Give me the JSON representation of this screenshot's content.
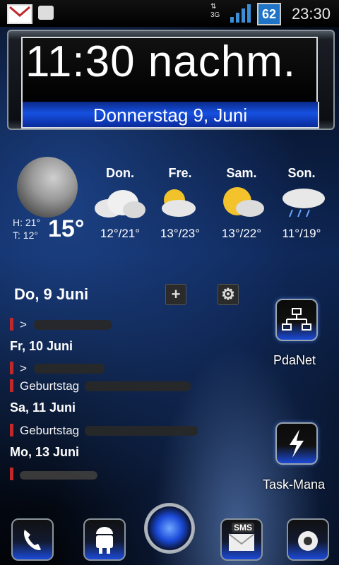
{
  "status_bar": {
    "network": "3G",
    "battery_level": "62",
    "time": "23:30"
  },
  "clock": {
    "time": "11:30 nachm.",
    "date": "Donnerstag 9, Juni"
  },
  "weather": {
    "current": {
      "high": "H: 21°",
      "low": "T: 12°",
      "temp": "15°"
    },
    "forecast": [
      {
        "day": "Don.",
        "range": "12°/21°",
        "icon": "cloudy-icon"
      },
      {
        "day": "Fre.",
        "range": "13°/23°",
        "icon": "partly-cloudy-icon"
      },
      {
        "day": "Sam.",
        "range": "13°/22°",
        "icon": "partly-sunny-icon"
      },
      {
        "day": "Son.",
        "range": "11°/19°",
        "icon": "rain-icon"
      }
    ]
  },
  "agenda": {
    "header": "Do, 9 Juni",
    "groups": [
      {
        "date": "Fr, 10 Juni",
        "events": [
          ">",
          "Geburtstag"
        ]
      },
      {
        "date": "Sa, 11 Juni",
        "events": [
          "Geburtstag"
        ]
      },
      {
        "date": "Mo, 13 Juni",
        "events": [
          ""
        ]
      }
    ],
    "first_event": ">"
  },
  "shortcuts": [
    {
      "label": "PdaNet",
      "icon": "network-icon"
    },
    {
      "label": "Task-Mana",
      "icon": "lightning-icon"
    }
  ],
  "dock": [
    {
      "name": "phone",
      "icon": "phone-icon"
    },
    {
      "name": "android",
      "icon": "android-icon"
    },
    {
      "name": "sms",
      "icon": "sms-icon",
      "label": "SMS"
    },
    {
      "name": "app",
      "icon": "app-icon"
    }
  ],
  "colors": {
    "accent": "#1650e0",
    "event_marker": "#c0282a"
  }
}
